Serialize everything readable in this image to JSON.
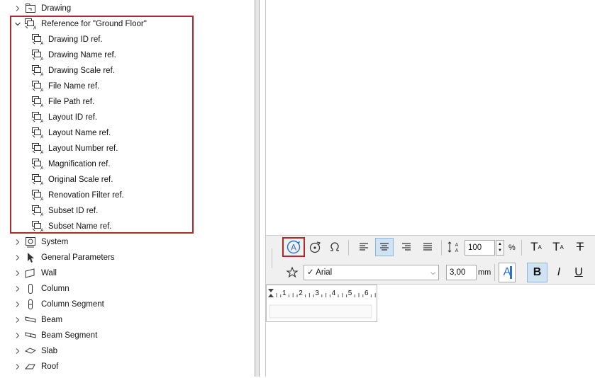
{
  "tree": {
    "top_items": [
      {
        "label": "Drawing",
        "icon": "drawing-icon"
      }
    ],
    "reference_group": {
      "label": "Reference for \"Ground Floor\"",
      "icon": "reference-autotext-icon",
      "children": [
        "Drawing ID ref.",
        "Drawing Name ref.",
        "Drawing Scale ref.",
        "File Name ref.",
        "File Path ref.",
        "Layout ID ref.",
        "Layout Name ref.",
        "Layout Number ref.",
        "Magnification ref.",
        "Original Scale ref.",
        "Renovation Filter ref.",
        "Subset ID ref.",
        "Subset Name ref."
      ]
    },
    "bottom_items": [
      {
        "label": "System",
        "icon": "system-icon"
      },
      {
        "label": "General Parameters",
        "icon": "arrow-pointer-icon"
      },
      {
        "label": "Wall",
        "icon": "wall-icon"
      },
      {
        "label": "Column",
        "icon": "column-icon"
      },
      {
        "label": "Column Segment",
        "icon": "column-segment-icon"
      },
      {
        "label": "Beam",
        "icon": "beam-icon"
      },
      {
        "label": "Beam Segment",
        "icon": "beam-segment-icon"
      },
      {
        "label": "Slab",
        "icon": "slab-icon"
      },
      {
        "label": "Roof",
        "icon": "roof-icon"
      }
    ]
  },
  "toolbar": {
    "scale_value": "100",
    "scale_unit": "%",
    "font_name": "Arial",
    "font_check": "✓",
    "size_value": "3,00",
    "size_unit": "mm",
    "color_swatch_letter": "A",
    "bold_label": "B",
    "italic_label": "I",
    "underline_label": "U",
    "superscript_label": "T",
    "superscript_mark": "A",
    "subscript_label": "T",
    "subscript_mark": "A",
    "strike_label": "T"
  },
  "ruler": {
    "ticks": [
      "1",
      "2",
      "3",
      "4",
      "5",
      "6"
    ]
  },
  "colors": {
    "highlight": "#b02a2a",
    "selected_bg": "#cfe3f5",
    "accent_blue": "#2f6fd0"
  }
}
